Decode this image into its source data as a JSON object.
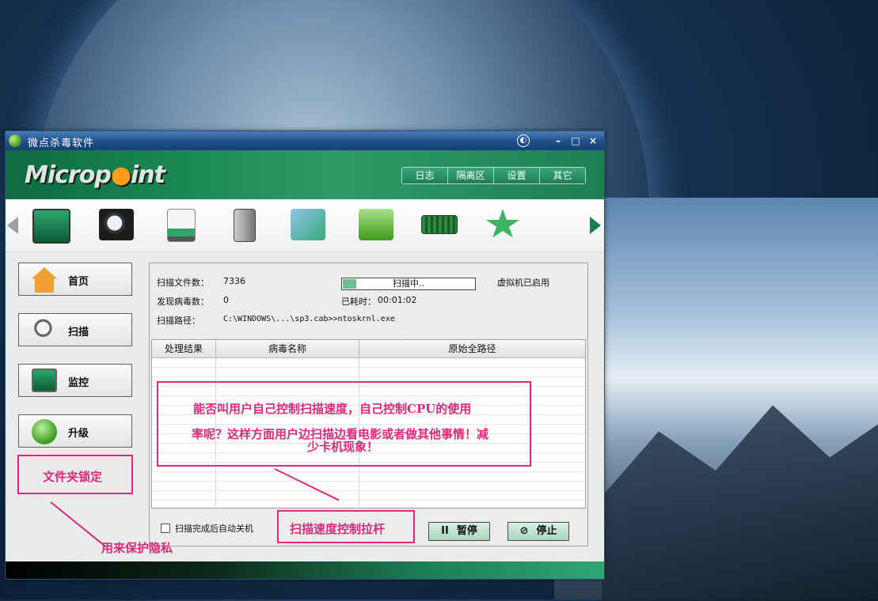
{
  "window": {
    "title": "微点杀毒软件",
    "brand_prefix": "Microp",
    "brand_suffix": "int",
    "minimize": "–",
    "maximize": "□",
    "close": "×",
    "skin": "◐"
  },
  "menu": [
    "日志",
    "隔离区",
    "设置",
    "其它"
  ],
  "toolbar": {
    "icons": [
      "monitor-icon",
      "magnifier-icon",
      "usb-drive-icon",
      "door-exit-icon",
      "network-folder-icon",
      "green-folder-icon",
      "memory-chip-icon",
      "star-icon"
    ]
  },
  "sidebar": [
    {
      "label": "首页",
      "icon": "home-icon"
    },
    {
      "label": "扫描",
      "icon": "magnifier-icon"
    },
    {
      "label": "监控",
      "icon": "monitor-icon"
    },
    {
      "label": "升级",
      "icon": "refresh-icon"
    }
  ],
  "scan": {
    "files_label": "扫描文件数：",
    "files_value": "7336",
    "virus_label": "发现病毒数：",
    "virus_value": "0",
    "path_label": "扫描路径：",
    "path_value": "C:\\WINDOWS\\...\\sp3.cab>>ntoskrnl.exe",
    "status": "扫描中..",
    "progress": 0.1,
    "elapsed_label": "已耗时：",
    "elapsed_value": "00:01:02",
    "vm_status": "虚拟机已启用"
  },
  "table": {
    "columns": [
      "处理结果",
      "病毒名称",
      "原始全路径"
    ]
  },
  "footer_controls": {
    "shutdown_label": "扫描完成后自动关机",
    "pause_label": "暂停",
    "pause_symbol": "II",
    "stop_label": "停止",
    "stop_symbol": "⊘"
  },
  "annotations": {
    "folder_lock": "文件夹锁定",
    "privacy": "用来保护隐私",
    "cpu_line1": "能否叫用户自己控制扫描速度，自己控制CPU的使用",
    "cpu_line2": "率呢？这样方面用户边扫描边看电影或者做其他事情！减",
    "cpu_line3": "少卡机现象！",
    "slider": "扫描速度控制拉杆"
  },
  "colors": {
    "accent_green": "#1e7e52",
    "annotation_pink": "#e0287a"
  }
}
